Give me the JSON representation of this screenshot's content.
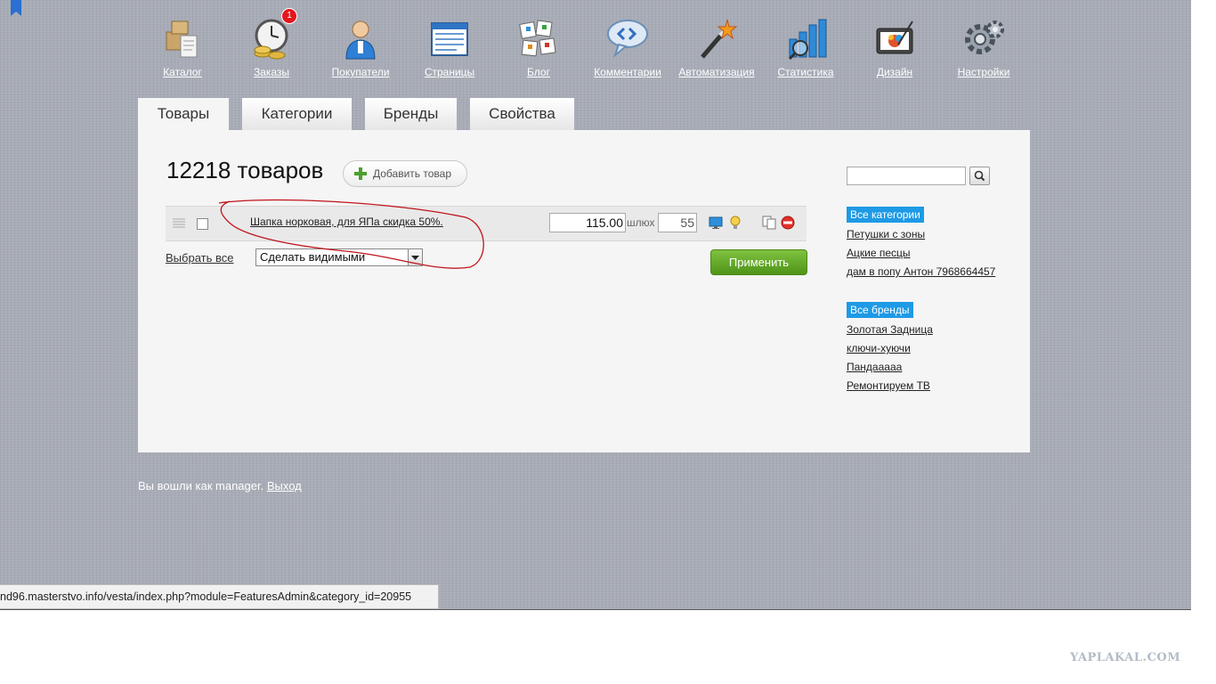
{
  "nav": {
    "items": [
      {
        "label": "Каталог",
        "icon": "catalog-icon"
      },
      {
        "label": "Заказы",
        "icon": "orders-icon",
        "badge": "1"
      },
      {
        "label": "Покупатели",
        "icon": "customers-icon"
      },
      {
        "label": "Страницы",
        "icon": "pages-icon"
      },
      {
        "label": "Блог",
        "icon": "blog-icon"
      },
      {
        "label": "Комментарии",
        "icon": "comments-icon"
      },
      {
        "label": "Автоматизация",
        "icon": "automation-icon"
      },
      {
        "label": "Статистика",
        "icon": "statistics-icon"
      },
      {
        "label": "Дизайн",
        "icon": "design-icon"
      },
      {
        "label": "Настройки",
        "icon": "settings-icon"
      }
    ]
  },
  "tabs": [
    {
      "label": "Товары",
      "active": true
    },
    {
      "label": "Категории"
    },
    {
      "label": "Бренды"
    },
    {
      "label": "Свойства"
    }
  ],
  "main": {
    "title": "12218 товаров",
    "add_button": "Добавить товар",
    "product": {
      "name": "Шапка норковая, для ЯПа скидка 50%.",
      "price": "115.00",
      "unit": "шлюх",
      "quantity": "55"
    },
    "select_all": "Выбрать все",
    "action_selected": "Сделать видимыми",
    "apply_button": "Применить"
  },
  "sidebar": {
    "search_value": "",
    "categories_header": "Все категории",
    "categories": [
      "Петушки с зоны",
      "Ацкие песцы",
      "дам в попу Антон 7968664457"
    ],
    "brands_header": "Все бренды",
    "brands": [
      "Золотая Задница",
      "ключи-хуючи",
      "Пандааааа",
      "Ремонтируем ТВ"
    ]
  },
  "footer": {
    "logged_in_text": "Вы вошли как manager.",
    "logout_label": "Выход"
  },
  "status_bar": {
    "url": "nd96.masterstvo.info/vesta/index.php?module=FeaturesAdmin&category_id=20955"
  },
  "watermark": "YAPLAKAL.COM",
  "colors": {
    "background": "#a8acb6",
    "highlight": "#1e9ae6",
    "apply_green": "#5ea324",
    "annotation_red": "#c0141b"
  }
}
